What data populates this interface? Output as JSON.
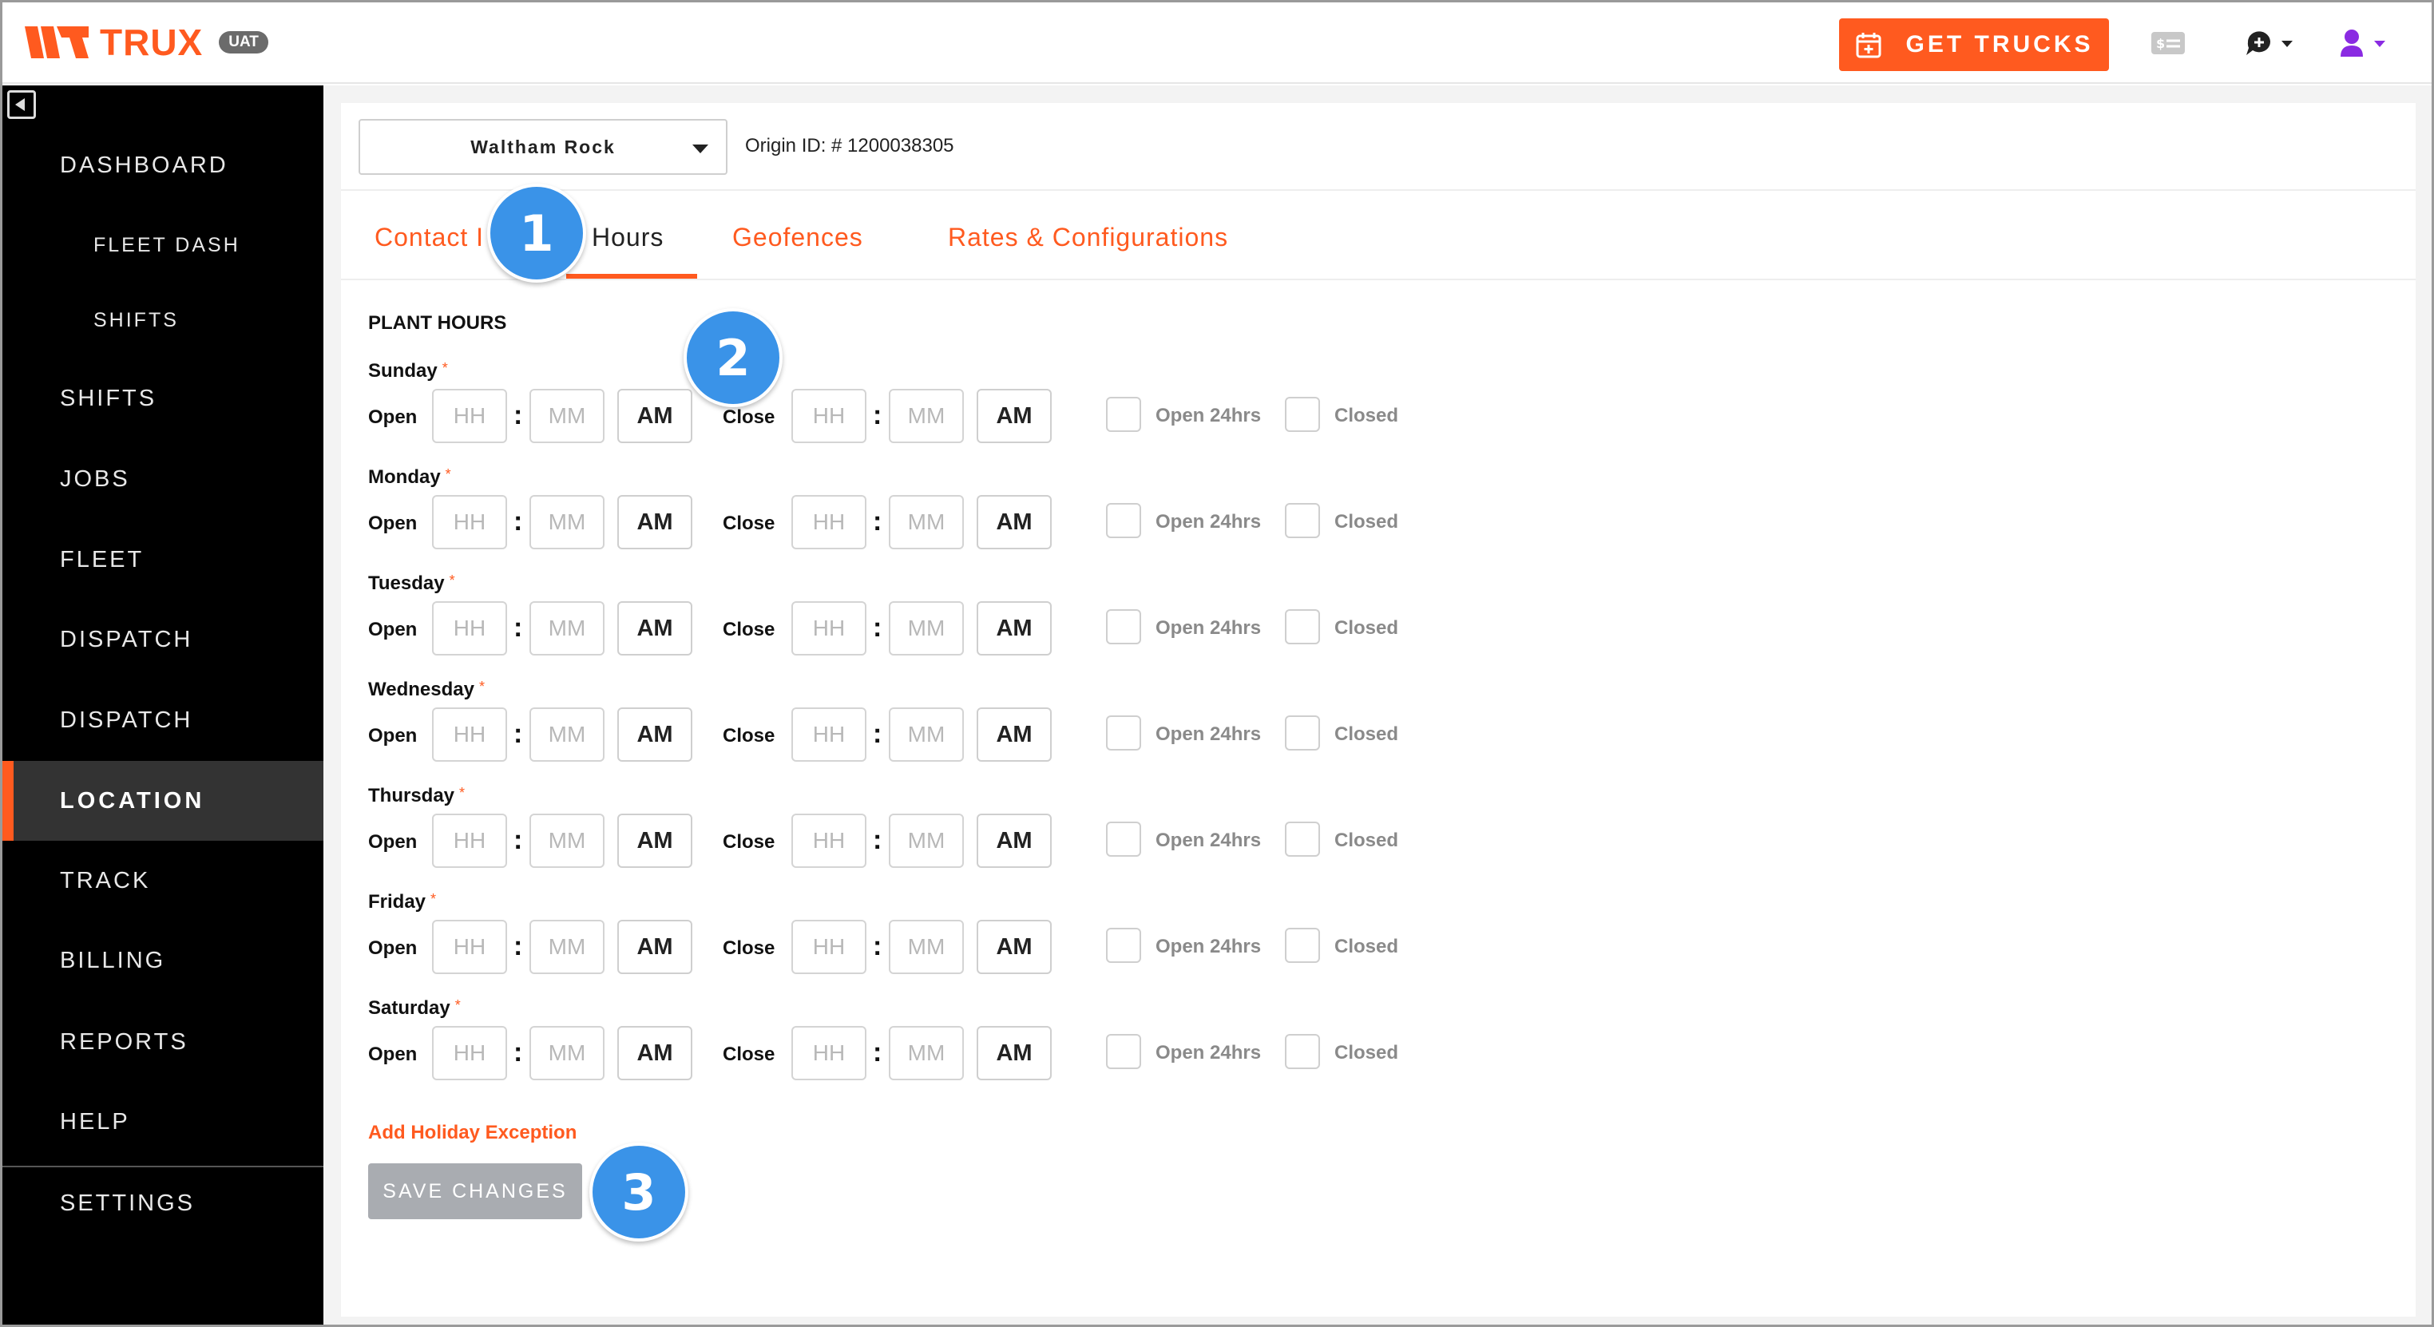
{
  "header": {
    "logo_text": "TRUX",
    "env_badge": "UAT",
    "cta_label": "GET TRUCKS",
    "icons": [
      "calendar-plus-icon",
      "billing-card-icon",
      "chat-icon",
      "user-icon"
    ],
    "brand_color": "#ff5a1f"
  },
  "sidebar": {
    "items": [
      {
        "label": "DASHBOARD"
      },
      {
        "label": "FLEET DASH"
      },
      {
        "label": "SHIFTS"
      },
      {
        "label": "SHIFTS"
      },
      {
        "label": "JOBS"
      },
      {
        "label": "FLEET"
      },
      {
        "label": "DISPATCH"
      },
      {
        "label": "DISPATCH"
      },
      {
        "label": "LOCATION"
      },
      {
        "label": "TRACK"
      },
      {
        "label": "BILLING"
      },
      {
        "label": "REPORTS"
      },
      {
        "label": "HELP"
      },
      {
        "label": "SETTINGS"
      }
    ],
    "active": "LOCATION"
  },
  "location": {
    "selected": "Waltham Rock",
    "origin_id": "Origin ID: # 1200038305"
  },
  "tabs": [
    {
      "label": "Contact I"
    },
    {
      "label": "Hours"
    },
    {
      "label": "Geofences"
    },
    {
      "label": "Rates & Configurations"
    }
  ],
  "active_tab": "Hours",
  "hours": {
    "title": "PLANT HOURS",
    "open_label": "Open",
    "close_label": "Close",
    "hh_placeholder": "HH",
    "mm_placeholder": "MM",
    "ampm": "AM",
    "open24_label": "Open 24hrs",
    "closed_label": "Closed",
    "required_mark": "*",
    "days": [
      "Sunday",
      "Monday",
      "Tuesday",
      "Wednesday",
      "Thursday",
      "Friday",
      "Saturday"
    ]
  },
  "actions": {
    "holiday": "Add Holiday Exception",
    "save": "SAVE CHANGES"
  },
  "callouts": [
    "1",
    "2",
    "3"
  ]
}
